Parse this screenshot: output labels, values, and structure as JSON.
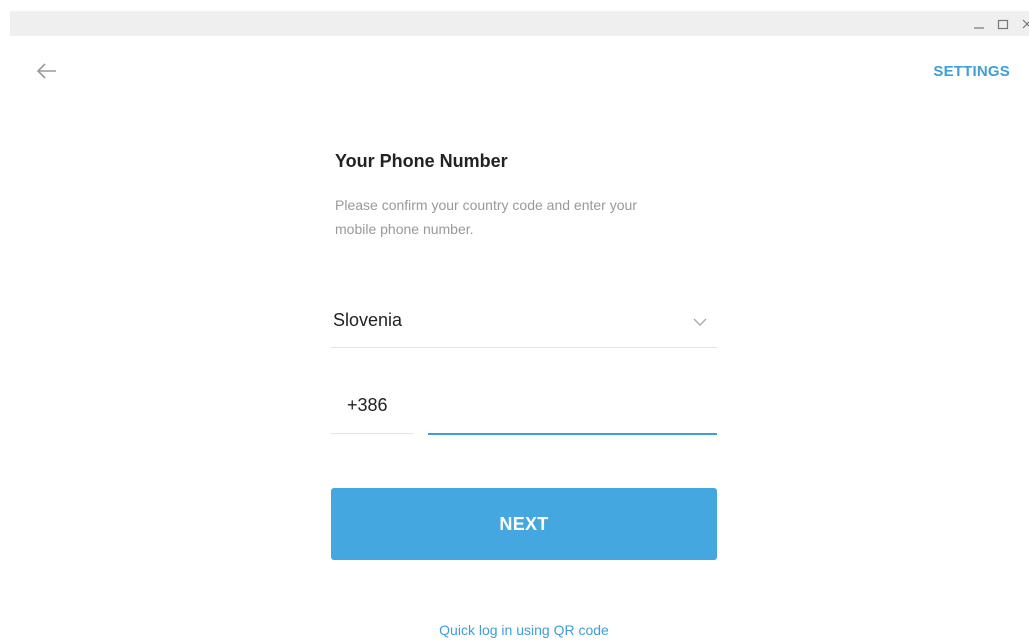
{
  "window": {
    "controls": [
      "minimize-icon",
      "maximize-icon",
      "close-icon"
    ]
  },
  "header": {
    "back_icon": "arrow-left-icon",
    "settings_label": "SETTINGS"
  },
  "form": {
    "title": "Your Phone Number",
    "description": "Please confirm your country code and enter your mobile phone number.",
    "country": "Slovenia",
    "country_chevron_icon": "chevron-down-icon",
    "country_code": "+386",
    "phone_value": "",
    "next_label": "NEXT"
  },
  "footer": {
    "qr_link": "Quick log in using QR code"
  },
  "colors": {
    "accent": "#3f9ed8",
    "button": "#45a7e0",
    "titlebar": "#efefef",
    "muted": "#999999"
  }
}
